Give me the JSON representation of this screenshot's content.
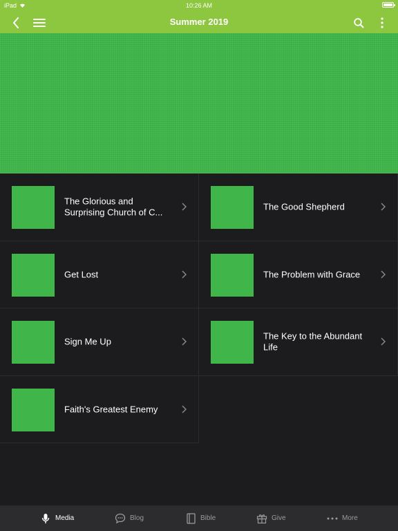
{
  "status": {
    "device": "iPad",
    "time": "10:26 AM"
  },
  "header": {
    "title": "Summer 2019"
  },
  "items": [
    {
      "title": "The Glorious and Surprising Church of C..."
    },
    {
      "title": "The Good Shepherd"
    },
    {
      "title": "Get Lost"
    },
    {
      "title": "The Problem with Grace"
    },
    {
      "title": "Sign Me Up"
    },
    {
      "title": "The Key to the Abundant Life"
    },
    {
      "title": "Faith's Greatest Enemy"
    }
  ],
  "tabs": [
    {
      "label": "Media",
      "icon": "microphone-icon",
      "active": true
    },
    {
      "label": "Blog",
      "icon": "speech-bubble-icon"
    },
    {
      "label": "Bible",
      "icon": "book-icon"
    },
    {
      "label": "Give",
      "icon": "gift-icon"
    },
    {
      "label": "More",
      "icon": "ellipsis-icon"
    }
  ],
  "colors": {
    "accent": "#8dc63f",
    "thumb": "#3fb54a",
    "background": "#1c1c1e",
    "tabbar": "#2c2c2e"
  }
}
